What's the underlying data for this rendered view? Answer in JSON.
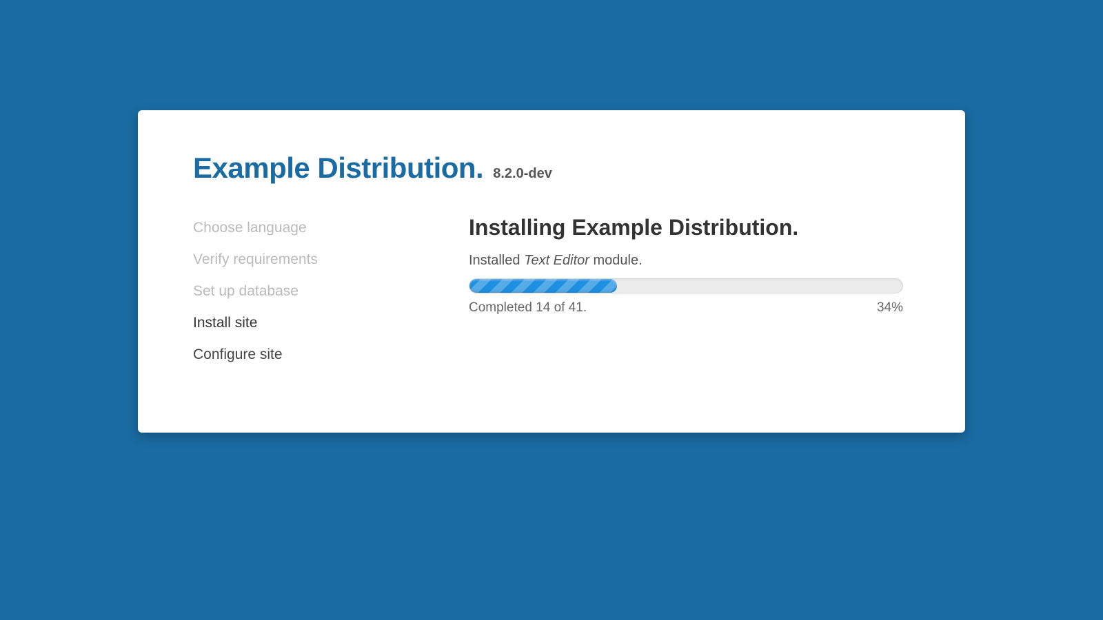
{
  "header": {
    "title": "Example Distribution.",
    "version": "8.2.0-dev"
  },
  "steps": {
    "choose_language": "Choose language",
    "verify_requirements": "Verify requirements",
    "setup_database": "Set up database",
    "install_site": "Install site",
    "configure_site": "Configure site"
  },
  "main": {
    "heading": "Installing Example Distribution.",
    "status_prefix": "Installed ",
    "status_module": "Text Editor",
    "status_suffix": " module.",
    "progress_percent": 34,
    "completed_label": "Completed 14 of 41.",
    "percent_label": "34%"
  },
  "colors": {
    "background": "#1a6ba3",
    "accent": "#1e90e0"
  }
}
